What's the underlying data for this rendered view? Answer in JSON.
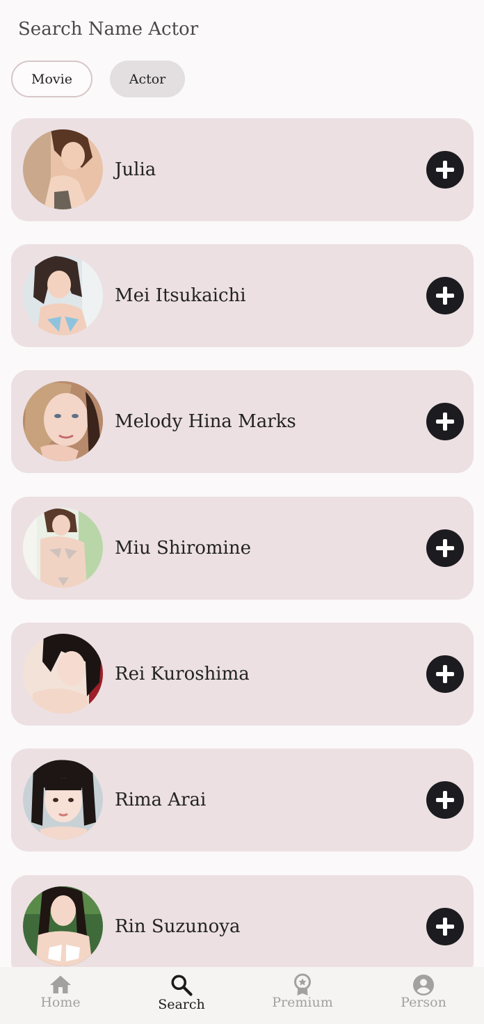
{
  "search": {
    "placeholder": "Search Name Actor"
  },
  "filters": {
    "movie_label": "Movie",
    "actor_label": "Actor",
    "selected": "Actor"
  },
  "actors": [
    {
      "name": "Julia"
    },
    {
      "name": "Mei Itsukaichi"
    },
    {
      "name": "Melody Hina Marks"
    },
    {
      "name": "Miu Shiromine"
    },
    {
      "name": "Rei Kuroshima"
    },
    {
      "name": "Rima Arai"
    },
    {
      "name": "Rin Suzunoya"
    }
  ],
  "bottom_nav": {
    "home_label": "Home",
    "search_label": "Search",
    "premium_label": "Premium",
    "person_label": "Person",
    "active": "Search"
  },
  "colors": {
    "background": "#fbf9f9",
    "card": "#ece0e3",
    "add_button": "#1c1b1f",
    "nav_inactive": "#a3a0a1",
    "nav_active": "#1b1b1b"
  }
}
